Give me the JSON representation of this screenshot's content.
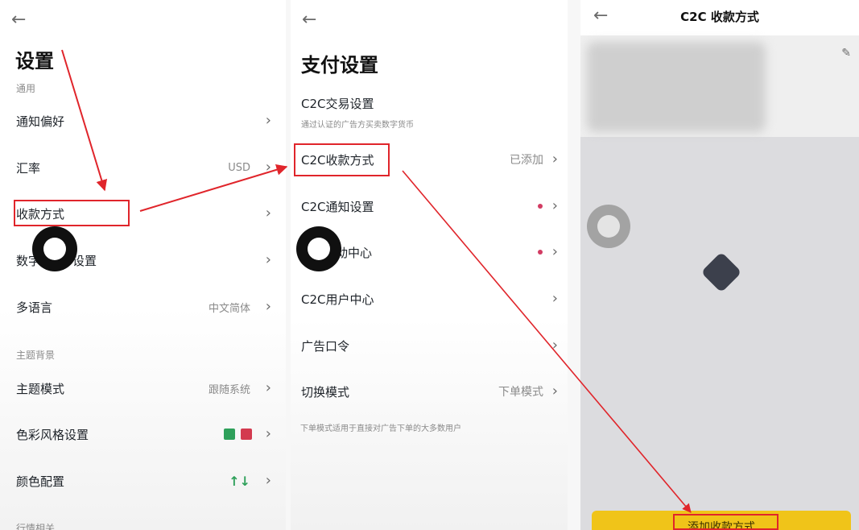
{
  "settings": {
    "title": "设置",
    "section_general": "通用",
    "items": [
      {
        "label": "通知偏好",
        "value": ""
      },
      {
        "label": "汇率",
        "value": "USD"
      },
      {
        "label": "收款方式",
        "value": ""
      },
      {
        "label": "数字",
        "label_tail": "设置",
        "value": ""
      },
      {
        "label": "多语言",
        "value": "中文简体"
      }
    ],
    "section_theme": "主题背景",
    "theme_items": [
      {
        "label": "主题模式",
        "value": "跟随系统"
      },
      {
        "label": "色彩风格设置",
        "value": ""
      },
      {
        "label": "颜色配置",
        "value": "↑↓"
      }
    ],
    "section_market": "行情相关",
    "swatch_colors": [
      "#2ea05a",
      "#d33a4f"
    ]
  },
  "payment": {
    "title": "支付设置",
    "items": [
      {
        "label": "C2C交易设置",
        "sub": "通过认证的广告方买卖数字货币",
        "value": ""
      },
      {
        "label": "C2C收款方式",
        "value": "已添加"
      },
      {
        "label": "C2C通知设置",
        "value": ""
      },
      {
        "label": "动中心",
        "value": ""
      },
      {
        "label": "C2C用户中心",
        "value": ""
      },
      {
        "label": "广告口令",
        "value": ""
      },
      {
        "label": "切换模式",
        "value": "下单模式"
      }
    ],
    "footnote": "下单模式适用于直接对广告下单的大多数用户"
  },
  "c2c": {
    "title": "C2C 收款方式",
    "add_button": "添加收款方式"
  },
  "icons": {
    "back": "←",
    "chevron": "›",
    "edit": "✎"
  },
  "colors": {
    "accent_yellow": "#f0c419",
    "annotation_red": "#e0252b",
    "dot_red": "#d23c63"
  }
}
